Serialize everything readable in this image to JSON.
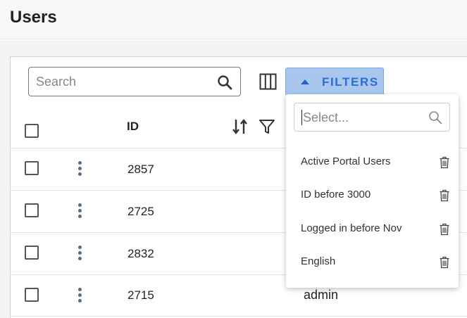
{
  "page": {
    "title": "Users"
  },
  "toolbar": {
    "search_placeholder": "Search",
    "filters_label": "FILTERS"
  },
  "table": {
    "columns": [
      "ID"
    ],
    "rows": [
      {
        "id": "2857",
        "username": ""
      },
      {
        "id": "2725",
        "username": ""
      },
      {
        "id": "2832",
        "username": ""
      },
      {
        "id": "2715",
        "username": "admin"
      }
    ]
  },
  "filters_dropdown": {
    "search_placeholder": "Select...",
    "saved_filters": [
      {
        "label": "Active Portal Users"
      },
      {
        "label": "ID before 3000"
      },
      {
        "label": "Logged in before Nov"
      },
      {
        "label": "English"
      }
    ]
  },
  "icons": {
    "search": "search-icon",
    "columns": "columns-icon",
    "caret_up": "caret-up-icon",
    "sort": "sort-icon",
    "filter": "filter-icon",
    "kebab": "kebab-menu-icon",
    "trash": "trash-icon"
  },
  "colors": {
    "filters_button_bg": "#a9c7ee",
    "filters_button_text": "#2a6fd1",
    "kebab": "#5b6d83"
  }
}
